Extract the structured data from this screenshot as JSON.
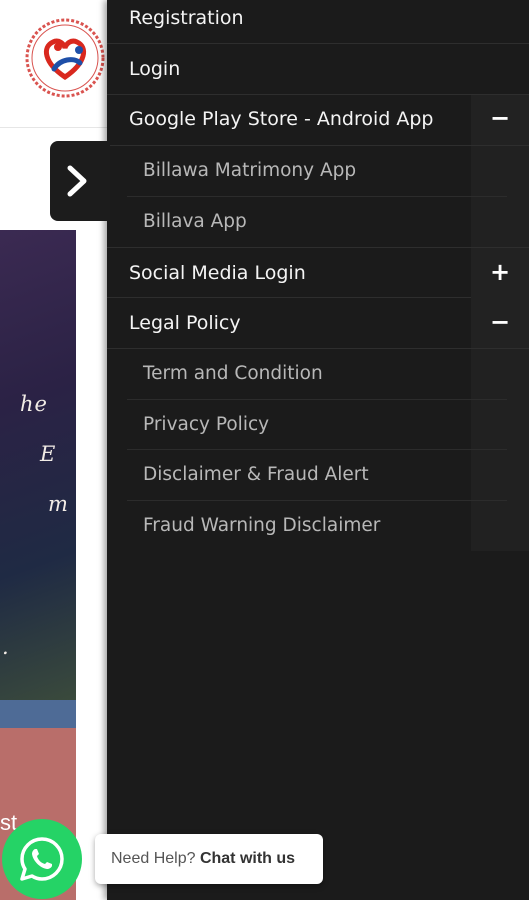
{
  "menu": {
    "items": [
      {
        "label": "Registration"
      },
      {
        "label": "Login"
      },
      {
        "label": "Google Play Store - Android App",
        "toggle": "−",
        "children": [
          {
            "label": "Billawa Matrimony App"
          },
          {
            "label": "Billava App"
          }
        ]
      },
      {
        "label": "Social Media Login",
        "toggle": "+"
      },
      {
        "label": "Legal Policy",
        "toggle": "−",
        "children": [
          {
            "label": "Term and Condition"
          },
          {
            "label": "Privacy Policy"
          },
          {
            "label": "Disclaimer & Fraud Alert"
          },
          {
            "label": "Fraud Warning Disclaimer"
          }
        ]
      }
    ]
  },
  "hero": {
    "lines": [
      "he",
      "E",
      "m",
      "."
    ],
    "partial_text": "st"
  },
  "chat": {
    "prefix": "Need Help?",
    "link": "Chat with us"
  },
  "colors": {
    "drawer_bg": "#1b1b1b",
    "whatsapp": "#25d366",
    "hero_pink": "#b96e6a",
    "hero_blue": "#4e6b96"
  },
  "icons": {
    "logo": "heart-rings-logo-icon",
    "toggle": "chevron-right-icon",
    "whatsapp": "whatsapp-icon"
  }
}
